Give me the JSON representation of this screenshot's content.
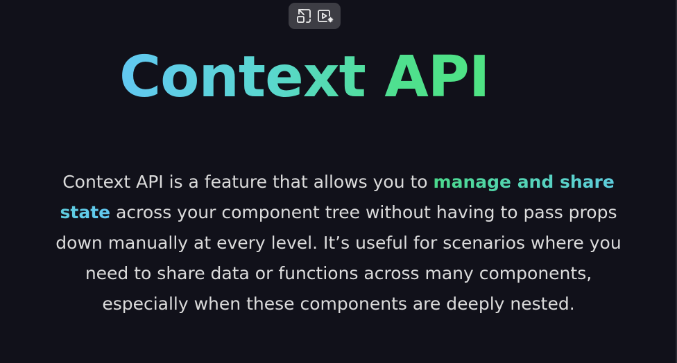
{
  "toolbar": {
    "buttons": [
      {
        "icon": "picture-in-picture-exit-icon"
      },
      {
        "icon": "video-effects-icon"
      }
    ]
  },
  "slide": {
    "title": "Context API",
    "description": {
      "before": "Context API is a feature that allows you to ",
      "highlight": "manage and share state",
      "after": " across your component tree without having to pass props down manually at every level. It’s useful for scenarios where you need to share data or functions across many components, especially when these components are deeply nested."
    }
  },
  "colors": {
    "background": "#11111a",
    "text": "#dcdcdc",
    "gradient_start": "#62c8f2",
    "gradient_end": "#4fe383"
  }
}
